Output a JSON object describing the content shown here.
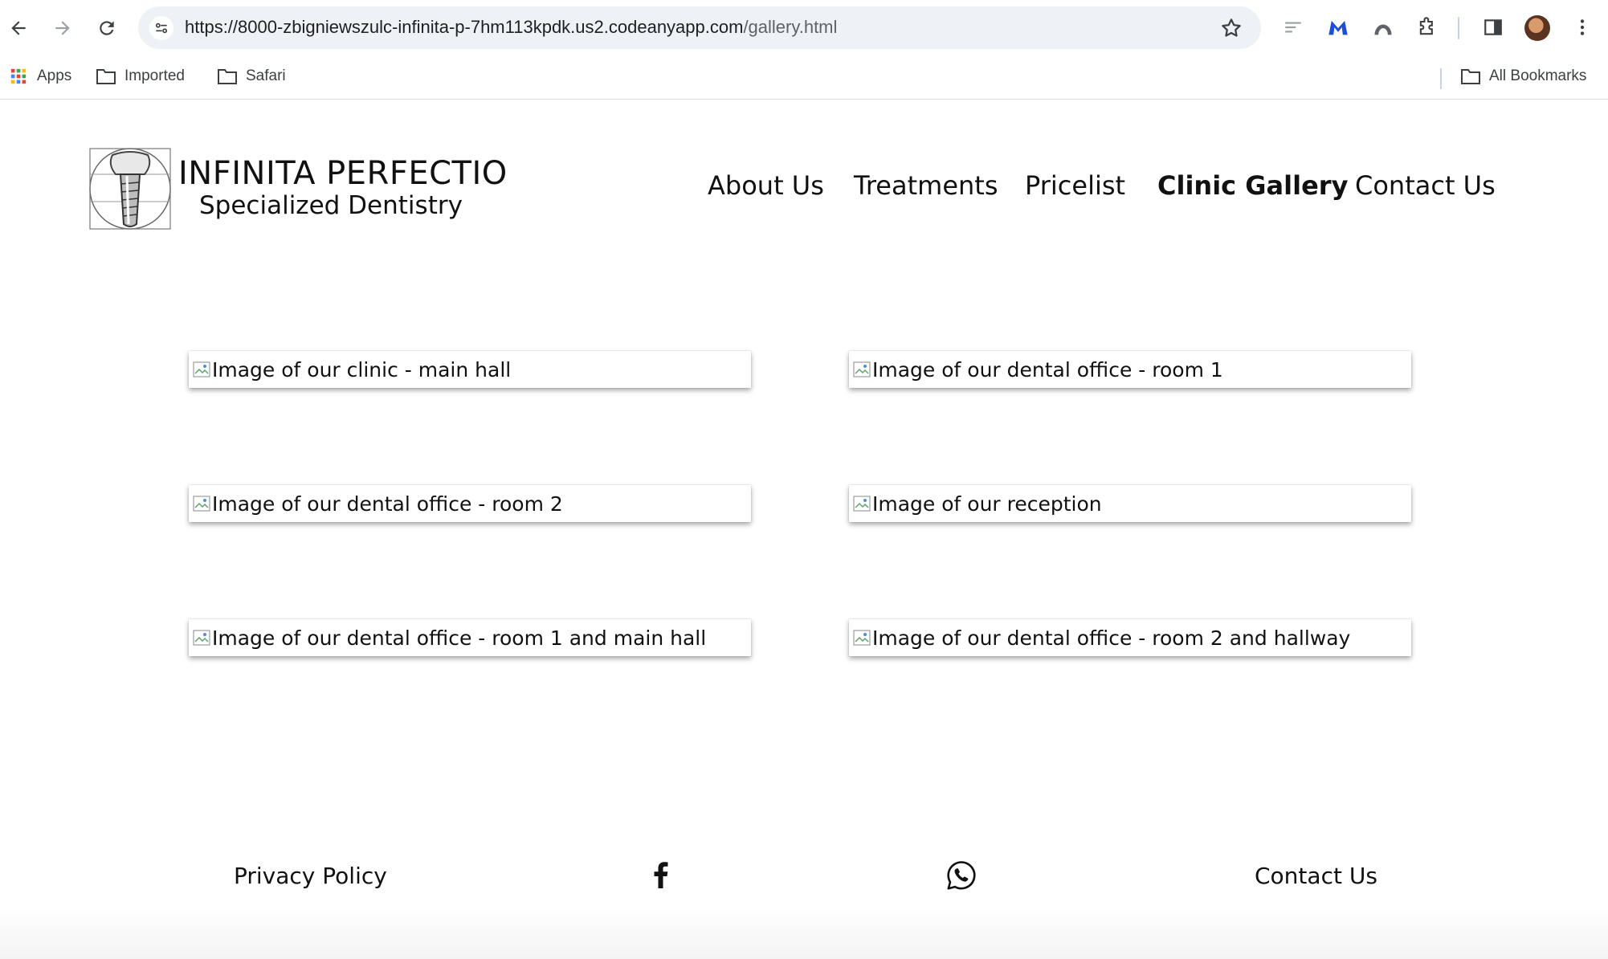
{
  "browser": {
    "url_main": "https://8000-zbigniewszulc-infinita-p-7hm113kpdk.us2.codeanyapp.com",
    "url_path": "/gallery.html",
    "bookmarks": [
      {
        "label": "Apps",
        "icon": "apps-grid-icon"
      },
      {
        "label": "Imported",
        "icon": "folder-icon"
      },
      {
        "label": "Safari",
        "icon": "folder-icon"
      }
    ],
    "all_bookmarks_label": "All Bookmarks"
  },
  "site": {
    "brand_name": "INFINITA PERFECTIO",
    "brand_subtitle": "Specialized Dentistry",
    "nav": [
      {
        "label": "About Us",
        "active": false
      },
      {
        "label": "Treatments",
        "active": false
      },
      {
        "label": "Pricelist",
        "active": false
      },
      {
        "label": "Clinic Gallery",
        "active": true
      },
      {
        "label": "Contact Us",
        "active": false
      }
    ]
  },
  "gallery": {
    "images": [
      {
        "alt": "Image of our clinic - main hall"
      },
      {
        "alt": "Image of our dental office - room 1"
      },
      {
        "alt": "Image of our dental office - room 2"
      },
      {
        "alt": "Image of our reception"
      },
      {
        "alt": "Image of our dental office - room 1 and main hall"
      },
      {
        "alt": "Image of our dental office - room 2 and hallway"
      }
    ]
  },
  "footer": {
    "privacy_label": "Privacy Policy",
    "contact_label": "Contact Us",
    "social": [
      "facebook-icon",
      "whatsapp-icon"
    ]
  },
  "colors": {
    "omnibox_bg": "#eef1f6",
    "text": "#111111",
    "chrome_icon": "#5f6368"
  }
}
